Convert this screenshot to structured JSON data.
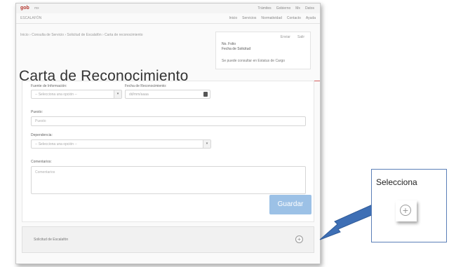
{
  "topbar": {
    "brand": "gob",
    "brand_sub": "mx",
    "links": [
      "Trámites",
      "Gobierno",
      "Mx",
      "Datos"
    ]
  },
  "subbar": {
    "left": "ESCALAFÓN",
    "menu": [
      "Inicio",
      "Servicios",
      "Normatividad",
      "Contacto",
      "Ayuda"
    ]
  },
  "breadcrumb": "Inicio › Consulta de Servicio › Solicitud de Escalafón › Carta de reconocimiento",
  "info": {
    "action1": "Enviar",
    "action2": "Salir",
    "line1": "No. Folio",
    "line2": "Fecha de Solicitud",
    "check": "Se puede consultar en Estatus de Cargo"
  },
  "page_title": "Carta de Reconocimiento",
  "form": {
    "field1_label": "Fuente de Información:",
    "field1_value": "-- Selecciona una opción --",
    "field2_label": "Fecha de Reconocimiento:",
    "field2_value": "dd/mm/aaaa",
    "field3_label": "Puesto:",
    "field3_placeholder": "Puesto",
    "field4_label": "Dependencia:",
    "field4_value": "-- Selecciona una opción --",
    "field5_label": "Comentarios:",
    "field5_placeholder": "Comentarios",
    "save_label": "Guardar"
  },
  "bottom": {
    "label": "Solicitud de Escalafón"
  },
  "callout": {
    "label": "Selecciona"
  },
  "icons": {
    "plus": "plus-circle-icon",
    "arrow": "pointer-arrow-icon",
    "calendar": "calendar-icon"
  },
  "colors": {
    "accent": "#9cc1e6",
    "brand": "#b3342c",
    "arrow": "#3e6fb5"
  }
}
